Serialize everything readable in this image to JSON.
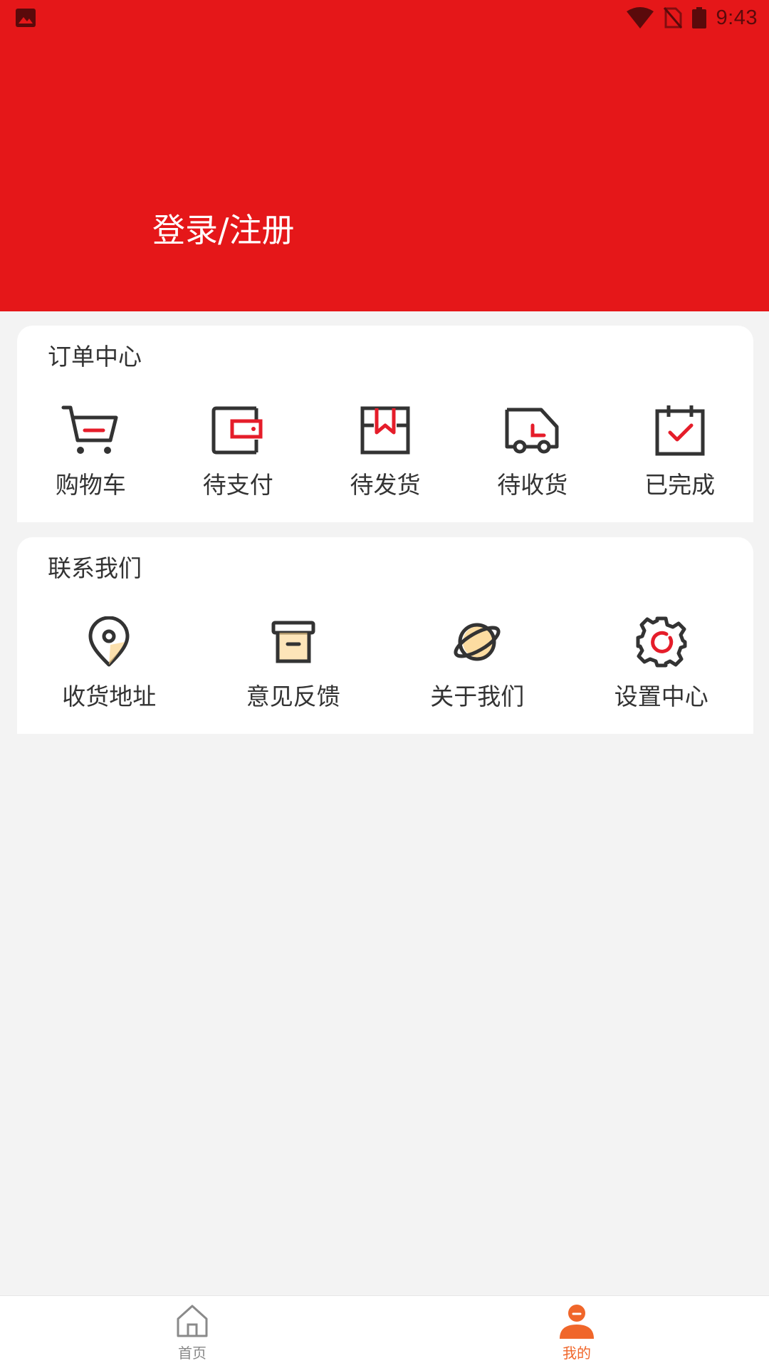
{
  "status_bar": {
    "time": "9:43",
    "left_icon": "image-icon",
    "right_icons": [
      "wifi-icon",
      "no-sim-icon",
      "battery-icon"
    ]
  },
  "header": {
    "login_label": "登录/注册",
    "background_color": "#e51719"
  },
  "orders": {
    "title": "订单中心",
    "items": [
      {
        "label": "购物车",
        "icon": "cart-icon"
      },
      {
        "label": "待支付",
        "icon": "wallet-icon"
      },
      {
        "label": "待发货",
        "icon": "box-icon"
      },
      {
        "label": "待收货",
        "icon": "truck-icon"
      },
      {
        "label": "已完成",
        "icon": "calendar-check-icon"
      }
    ]
  },
  "contact": {
    "title": "联系我们",
    "items": [
      {
        "label": "收货地址",
        "icon": "location-pin-icon"
      },
      {
        "label": "意见反馈",
        "icon": "archive-box-icon"
      },
      {
        "label": "关于我们",
        "icon": "planet-icon"
      },
      {
        "label": "设置中心",
        "icon": "gear-icon"
      }
    ]
  },
  "bottom_nav": {
    "items": [
      {
        "label": "首页",
        "icon": "home-icon",
        "active": false
      },
      {
        "label": "我的",
        "icon": "user-icon",
        "active": true
      }
    ],
    "active_color": "#f0662a",
    "inactive_color": "#888888"
  }
}
